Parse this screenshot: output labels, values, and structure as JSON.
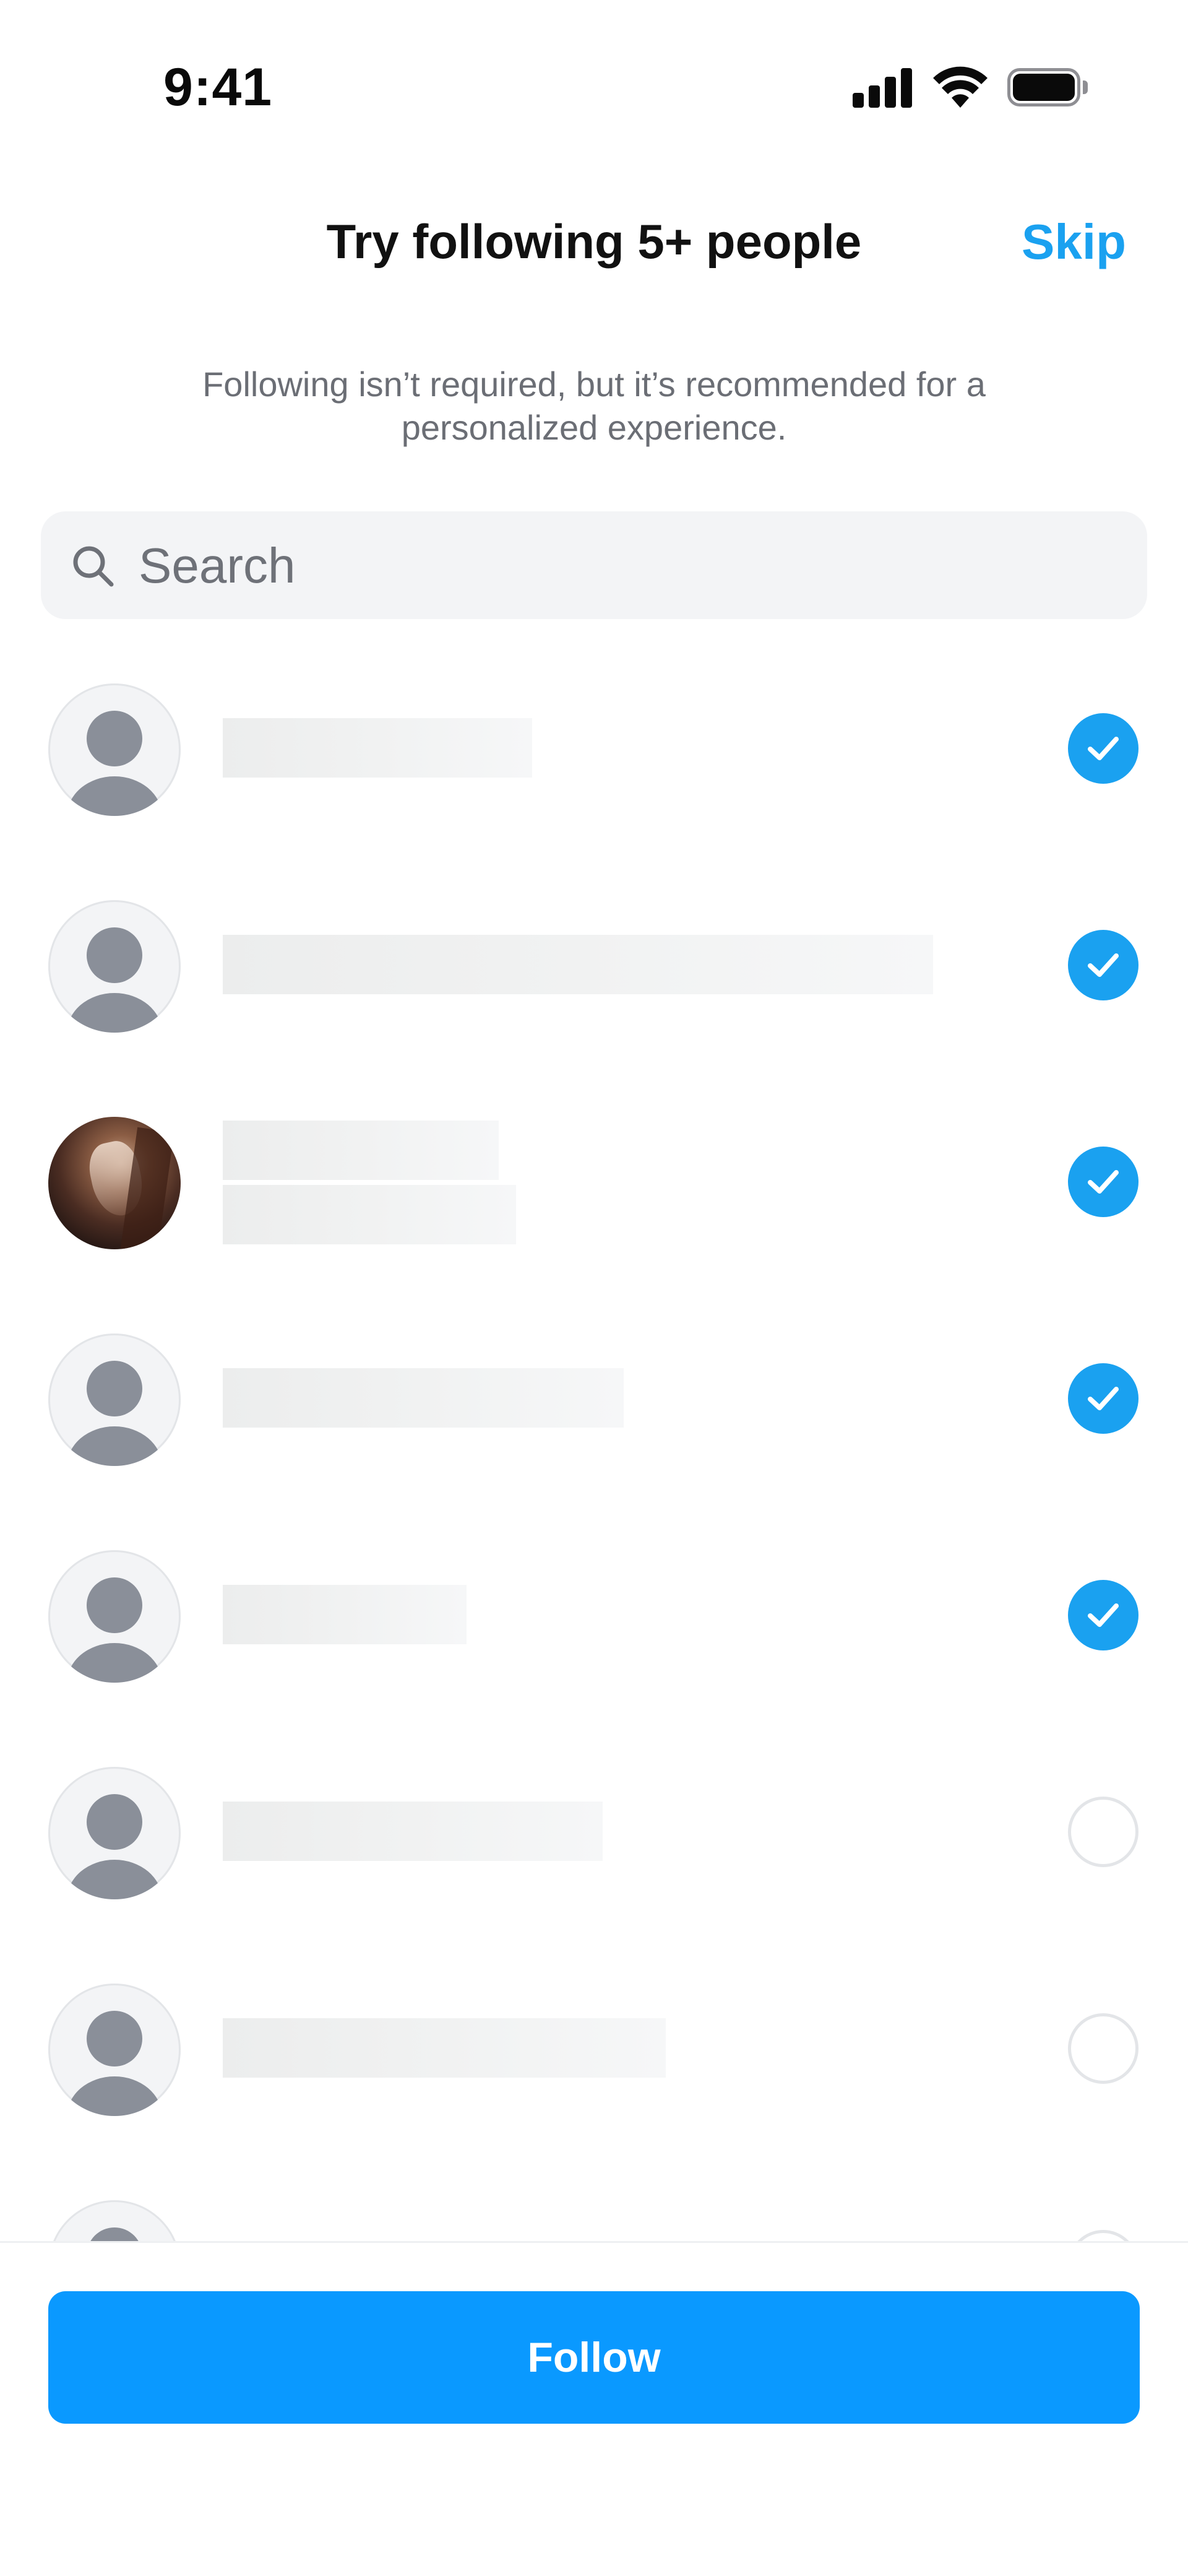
{
  "status_bar": {
    "time": "9:41",
    "icons": [
      "signal-icon",
      "wifi-icon",
      "battery-icon"
    ]
  },
  "header": {
    "title": "Try following 5+ people",
    "skip_label": "Skip"
  },
  "subtitle": "Following isn’t required, but it’s recommended for a personalized experience.",
  "search": {
    "placeholder": "Search",
    "value": ""
  },
  "people": [
    {
      "avatar": "default",
      "selected": true
    },
    {
      "avatar": "default",
      "selected": true
    },
    {
      "avatar": "photo",
      "selected": true
    },
    {
      "avatar": "default",
      "selected": true
    },
    {
      "avatar": "default",
      "selected": true
    },
    {
      "avatar": "default",
      "selected": false
    },
    {
      "avatar": "default",
      "selected": false
    },
    {
      "avatar": "default",
      "selected": false
    }
  ],
  "footer": {
    "follow_label": "Follow"
  },
  "colors": {
    "accent": "#1aa1f0",
    "button": "#0a99ff",
    "placeholder_avatar": "#8a8f99",
    "subtitle_text": "#6b6e75"
  }
}
